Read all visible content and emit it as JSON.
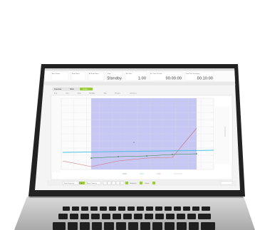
{
  "header": {
    "fields": [
      {
        "label": "Base Station",
        "value": ""
      },
      {
        "label": "Probe Name",
        "value": ""
      },
      {
        "label": "Alt Probe Name",
        "value": ""
      },
      {
        "label": "State",
        "value": "Standby"
      },
      {
        "label": "Run Time",
        "value": "1:00"
      },
      {
        "label": "Est. Time To Finish",
        "value": "00:00:00"
      },
      {
        "label": "Total Time Remaining",
        "value": "00:10:00"
      }
    ]
  },
  "tabs": [
    {
      "label": "Overview",
      "active": false
    },
    {
      "label": "Table",
      "active": false
    },
    {
      "label": "Graph",
      "active": true
    }
  ],
  "subtabs": [
    "Step",
    "Time",
    "Temp",
    "Humidity",
    "Max",
    "Pressure",
    "Limit Lines"
  ],
  "controls": {
    "start_label": "Start Frequency",
    "play_label": "▶",
    "reset_label": "Reset Channels",
    "auto_label": "Autoscale",
    "output_label": "Output"
  },
  "colors": {
    "desk": "#c8c8c8",
    "bezel": "#2a2a2a",
    "screen": "#f3f3f3",
    "accent_green": "#9acd32",
    "plot_shade": "#b5b5f0",
    "series_red": "#d07070",
    "series_cyan": "#40c0e0",
    "series_green": "#208040"
  }
}
